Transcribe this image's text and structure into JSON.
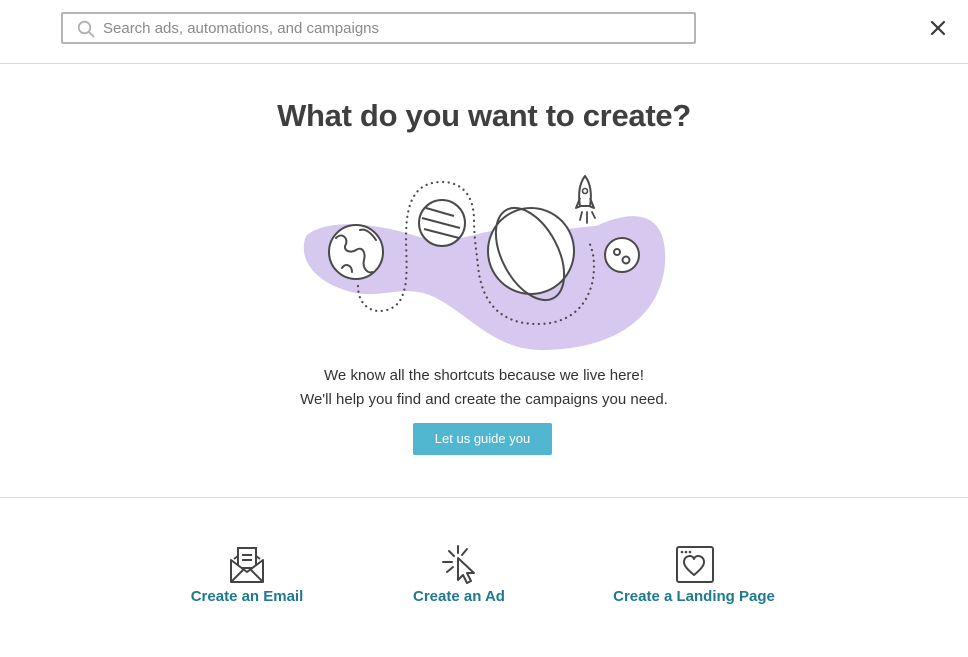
{
  "search": {
    "placeholder": "Search ads, automations, and campaigns",
    "value": ""
  },
  "hero": {
    "title": "What do you want to create?",
    "line1": "We know all the shortcuts because we live here!",
    "line2": "We'll help you find and create the campaigns you need.",
    "guide_button": "Let us guide you"
  },
  "create_options": [
    {
      "label": "Create an Email",
      "icon": "envelope-icon"
    },
    {
      "label": "Create an Ad",
      "icon": "cursor-click-icon"
    },
    {
      "label": "Create a Landing Page",
      "icon": "landing-page-heart-icon"
    }
  ],
  "colors": {
    "accent": "#51b6d0",
    "link": "#1f7a90",
    "blob": "#d7c8ef",
    "title": "#3f3f3f",
    "border": "#d9d9d9"
  }
}
